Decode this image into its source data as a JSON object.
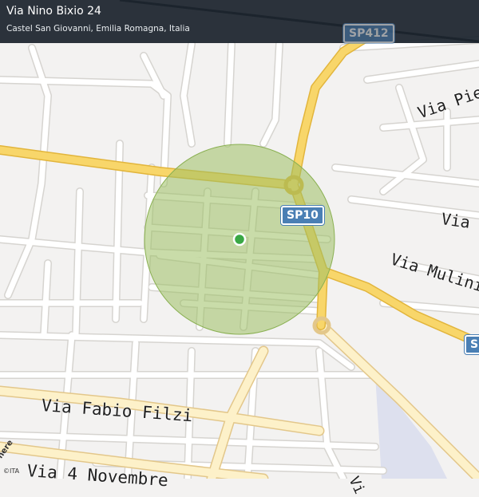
{
  "header": {
    "title": "Via Nino Bixio 24",
    "subtitle": "Castel San Giovanni, Emilia Romagna, Italia"
  },
  "road_shields": {
    "sp412": "SP412",
    "sp10": "SP10",
    "sp_edge": "SP"
  },
  "street_labels": {
    "via_pie": "Via Pie",
    "via_d": "Via D",
    "via_mulini": "Via Mulini",
    "via_fabio_filzi": "Via Fabio Filzi",
    "via_4_novembre": "Via 4 Novembre",
    "via_edge": "Vi"
  },
  "branding": {
    "logo": "here",
    "attribution": "©ITA"
  },
  "map": {
    "colors": {
      "background": "#f3f2f1",
      "street": "#ffffff",
      "street_outline": "#d6d4d0",
      "highway": "#f8d66a",
      "highway_outline": "#e2b53c",
      "water": "#dde0ee",
      "radius_fill": "#9cbf63",
      "pin": "#3aa845",
      "shield": "#4a7fb4"
    },
    "radius_circle": true,
    "location_pin": true
  }
}
